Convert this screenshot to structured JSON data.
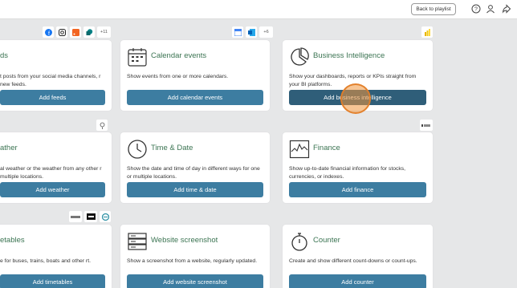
{
  "header": {
    "back_label": "Back to playlist",
    "icons": [
      "help-icon",
      "user-icon",
      "share-icon"
    ]
  },
  "chips": {
    "feeds": [
      "facebook-icon",
      "instagram-icon",
      "rss-icon",
      "sharepoint-icon"
    ],
    "feeds_more": "+11",
    "calendar": [
      "google-calendar-icon",
      "outlook-icon"
    ],
    "calendar_more": "+6",
    "bi": [
      "powerbi-icon"
    ],
    "weather": [
      "weather-icon"
    ],
    "finance": [
      "finance-brand-icon"
    ],
    "timetables": [
      "transit-brand-icon",
      "rail-brand-icon",
      "transit-logo-icon"
    ]
  },
  "cards": {
    "feeds": {
      "title": "ds",
      "desc": "t posts from your social media channels, r new feeds.",
      "button": "Add feeds"
    },
    "calendar": {
      "title": "Calendar events",
      "desc": "Show events from one or more calendars.",
      "button": "Add calendar events"
    },
    "bi": {
      "title": "Business Intelligence",
      "desc": "Show your dashboards, reports or KPIs straight from your BI platforms.",
      "button": "Add business intelligence"
    },
    "weather": {
      "title": "ather",
      "desc": "al weather or the weather from any other r multiple locations.",
      "button": "Add weather"
    },
    "time": {
      "title": "Time & Date",
      "desc": "Show the date and time of day in different ways for one or multiple locations.",
      "button": "Add time & date"
    },
    "finance": {
      "title": "Finance",
      "desc": "Show up-to-date financial information for stocks, currencies, or indexes.",
      "button": "Add finance"
    },
    "timetables": {
      "title": "etables",
      "desc": "e for buses, trains, boats and other rt.",
      "button": "Add timetables"
    },
    "screenshot": {
      "title": "Website screenshot",
      "desc": "Show a screenshot from a website, regularly updated.",
      "button": "Add website screenshot"
    },
    "counter": {
      "title": "Counter",
      "desc": "Create and show different count-downs or count-ups.",
      "button": "Add counter"
    }
  },
  "colors": {
    "title_green": "#3b7452",
    "button_blue": "#3d7da1",
    "button_active": "#2f5e79",
    "cursor_orange": "#f0963c"
  }
}
